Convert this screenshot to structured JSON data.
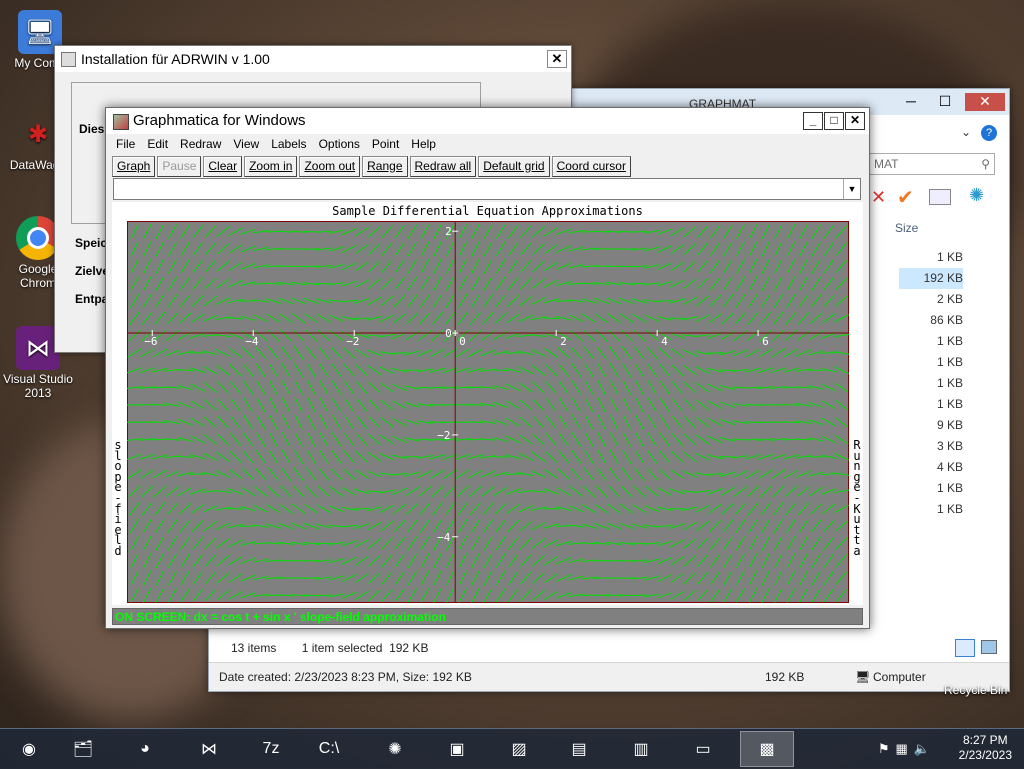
{
  "desktop": {
    "icons": [
      {
        "label": "My Comp",
        "icon": "computer-icon"
      },
      {
        "label": "DataWage",
        "icon": "datawage-icon"
      },
      {
        "label": "Google Chrom",
        "icon": "chrome-icon"
      },
      {
        "label": "Visual Studio 2013",
        "icon": "visual-studio-icon"
      }
    ],
    "recycle_label": "Recycle Bin"
  },
  "explorer": {
    "title": "GRAPHMAT",
    "search_placeholder": "MAT",
    "size_header": "Size",
    "sizes": [
      "1 KB",
      "192 KB",
      "2 KB",
      "86 KB",
      "1 KB",
      "1 KB",
      "1 KB",
      "1 KB",
      "9 KB",
      "3 KB",
      "4 KB",
      "1 KB",
      "1 KB"
    ],
    "selected_index": 1,
    "items_count": "13 items",
    "selected_info": "1 item selected  192 KB",
    "detail": "Date created: 2/23/2023 8:23 PM, Size: 192 KB",
    "detail_size": "192 KB",
    "detail_location": "Computer"
  },
  "installer": {
    "title": "Installation für ADRWIN v 1.00",
    "labels": [
      "Dies",
      "Speic",
      "Zielve",
      "Entpa"
    ]
  },
  "graphmatica": {
    "title": "Graphmatica for Windows",
    "menu": [
      "File",
      "Edit",
      "Redraw",
      "View",
      "Labels",
      "Options",
      "Point",
      "Help"
    ],
    "toolbar": [
      {
        "label": "Graph",
        "disabled": false
      },
      {
        "label": "Pause",
        "disabled": true
      },
      {
        "label": "Clear",
        "disabled": false
      },
      {
        "label": "Zoom in",
        "disabled": false
      },
      {
        "label": "Zoom out",
        "disabled": false
      },
      {
        "label": "Range",
        "disabled": false
      },
      {
        "label": "Redraw all",
        "disabled": false
      },
      {
        "label": "Default grid",
        "disabled": false
      },
      {
        "label": "Coord cursor",
        "disabled": false
      }
    ],
    "equation_value": "",
    "graph_title": "Sample Differential Equation Approximations",
    "left_label": "slope-field",
    "right_label": "Runge-Kutta",
    "status": "ON SCREEN: dx = cos t + sin x  ' slope-field approximation",
    "colors": {
      "plot_bg": "#808080",
      "frame": "#800000",
      "field": "#00e000",
      "axis": "#800000"
    }
  },
  "chart_data": {
    "type": "slope-field",
    "title": "Sample Differential Equation Approximations",
    "equation": "dx = cos t + sin x",
    "xlim": [
      -6.5,
      7.8
    ],
    "ylim": [
      -5.3,
      2.2
    ],
    "x_ticks": [
      -6,
      -4,
      -2,
      0,
      2,
      4,
      6
    ],
    "y_ticks": [
      2,
      0,
      -2,
      -4
    ],
    "grid": false
  },
  "taskbar": {
    "time": "8:27 PM",
    "date": "2/23/2023",
    "items": [
      "start-orb-icon",
      "explorer-icon",
      "chrome-icon",
      "visual-studio-icon",
      "7zip-icon",
      "cmd-icon",
      "shell-icon",
      "vcdic-icon",
      "photo-icon",
      "window-icon",
      "window2-icon",
      "printer-icon",
      "graphmatica-icon"
    ]
  }
}
